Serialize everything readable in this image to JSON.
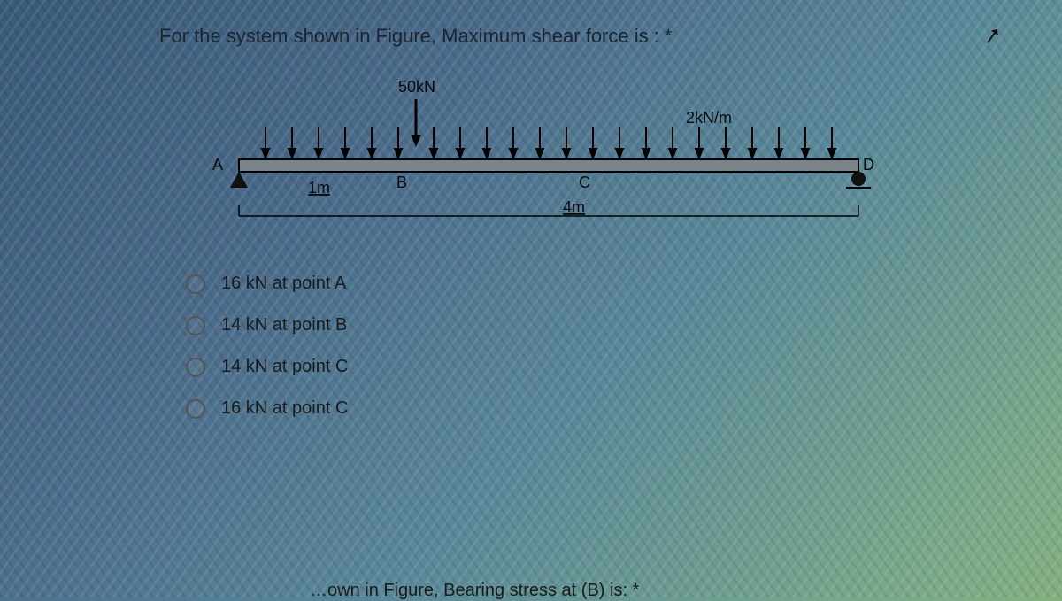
{
  "question": {
    "title": "For the system shown in Figure, Maximum shear force is : *"
  },
  "figure": {
    "point_load_label": "50kN",
    "udl_label": "2kN/m",
    "labels": {
      "A": "A",
      "B": "B",
      "C": "C",
      "D": "D"
    },
    "dim_ab": "1m",
    "dim_bd": "4m"
  },
  "options": [
    {
      "label": "16 kN at point A"
    },
    {
      "label": "14 kN at point B"
    },
    {
      "label": "14 kN at point C"
    },
    {
      "label": "16 kN at point C"
    }
  ],
  "next_question_fragment": "…own in Figure, Bearing stress at (B) is: *",
  "chart_data": {
    "type": "table",
    "description": "Simply supported beam with pin at A and roller at D. Uniformly distributed load across full span A→D, and a 50 kN point load at B.",
    "geometry": {
      "A_x_m": 0,
      "B_x_m": 1,
      "C_x_m": 3,
      "D_x_m": 5,
      "span_AD_m": 5,
      "dim_AB_m": 1,
      "dim_BD_m": 4
    },
    "loads": {
      "udl_kN_per_m": 2,
      "udl_from": "A",
      "udl_to": "D",
      "point_load_kN": 50,
      "point_load_at": "B"
    },
    "supports": {
      "A": "pin",
      "D": "roller"
    }
  }
}
